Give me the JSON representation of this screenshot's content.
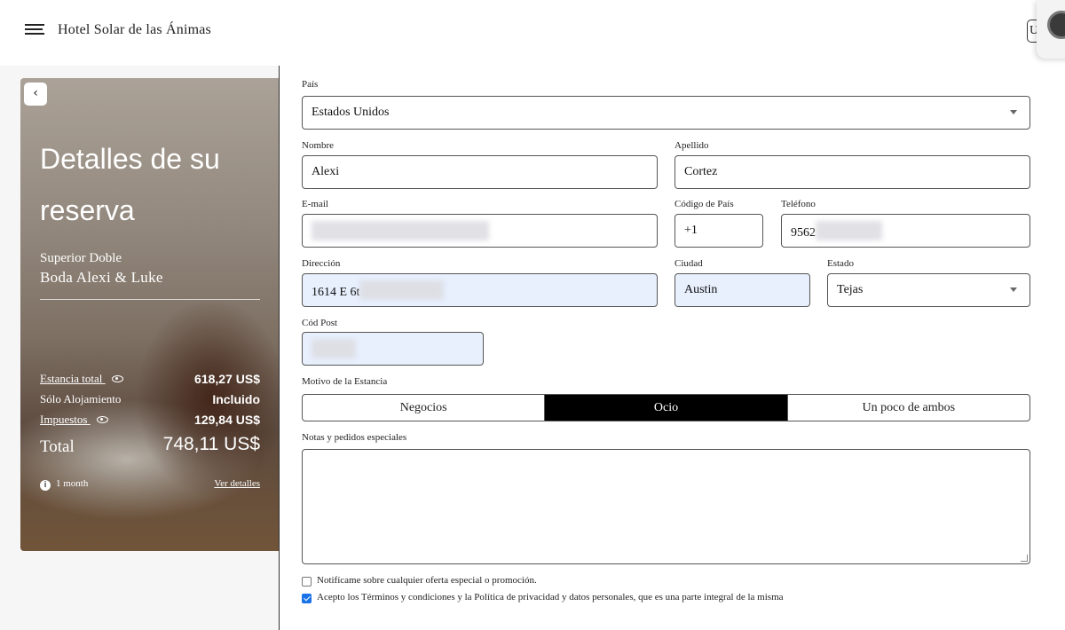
{
  "header": {
    "hotel_name": "Hotel Solar de las Ánimas",
    "user_initial": "U"
  },
  "summary": {
    "title_line1": "Detalles de su",
    "title_line2": "reserva",
    "room_type": "Superior Doble",
    "booking_name": "Boda Alexi & Luke",
    "rows": [
      {
        "label": "Estancia total",
        "value": "618,27 US$",
        "link": true
      },
      {
        "label": "Sólo Alojamiento",
        "value": "Incluido",
        "link": false
      },
      {
        "label": "Impuestos",
        "value": "129,84 US$",
        "link": true
      }
    ],
    "total_label": "Total",
    "total_value": "748,11 US$",
    "info_icon": "i",
    "duration": "1 month",
    "details_link": "Ver detalles"
  },
  "form": {
    "country_label": "País",
    "country_value": "Estados Unidos",
    "first_name_label": "Nombre",
    "first_name_value": "Alexi",
    "last_name_label": "Apellido",
    "last_name_value": "Cortez",
    "email_label": "E-mail",
    "country_code_label": "Código de País",
    "country_code_value": "+1",
    "phone_label": "Teléfono",
    "phone_value_visible": "9562",
    "address_label": "Dirección",
    "address_value_visible": "1614 E 6t",
    "city_label": "Ciudad",
    "city_value": "Austin",
    "state_label": "Estado",
    "state_value": "Tejas",
    "zip_label": "Cód Post",
    "reason_label": "Motivo de la Estancia",
    "reason_options": [
      "Negocios",
      "Ocio",
      "Un poco de ambos"
    ],
    "reason_selected": "Ocio",
    "notes_label": "Notas y pedidos especiales",
    "notify_text": "Notifícame sobre cualquier oferta especial o promoción.",
    "notify_checked": false,
    "terms_text": "Acepto los Términos y condiciones y la Política de privacidad y datos personales, que es una parte integral de la misma",
    "terms_checked": true
  },
  "colors": {
    "accent_selected": "#000000",
    "checkbox_checked": "#1a73e8",
    "autofill_bg": "#e8f0fe"
  }
}
